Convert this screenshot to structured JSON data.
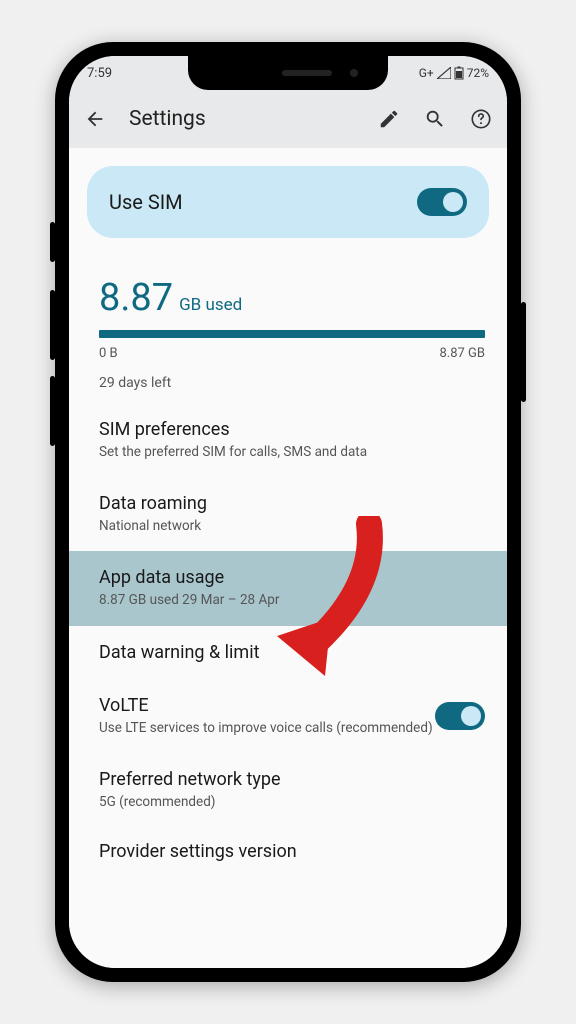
{
  "status_bar": {
    "time": "7:59",
    "network_indicator": "G+",
    "battery": "72%"
  },
  "app_bar": {
    "title": "Settings"
  },
  "sim_card": {
    "label": "Use SIM",
    "enabled": true
  },
  "usage": {
    "value": "8.87",
    "unit": "GB used",
    "range_start": "0 B",
    "range_end": "8.87 GB",
    "days_left": "29 days left"
  },
  "items": {
    "sim_prefs": {
      "title": "SIM preferences",
      "subtitle": "Set the preferred SIM for calls, SMS and data"
    },
    "roaming": {
      "title": "Data roaming",
      "subtitle": "National network"
    },
    "app_data": {
      "title": "App data usage",
      "subtitle": "8.87 GB used 29 Mar – 28 Apr"
    },
    "warning": {
      "title": "Data warning & limit"
    },
    "volte": {
      "title": "VoLTE",
      "subtitle": "Use LTE services to improve voice calls (recommended)",
      "enabled": true
    },
    "network_type": {
      "title": "Preferred network type",
      "subtitle": "5G (recommended)"
    },
    "provider": {
      "title": "Provider settings version"
    }
  },
  "colors": {
    "accent": "#0f6a81",
    "accent_light": "#cae8f5",
    "highlight": "#a9c6cd"
  }
}
